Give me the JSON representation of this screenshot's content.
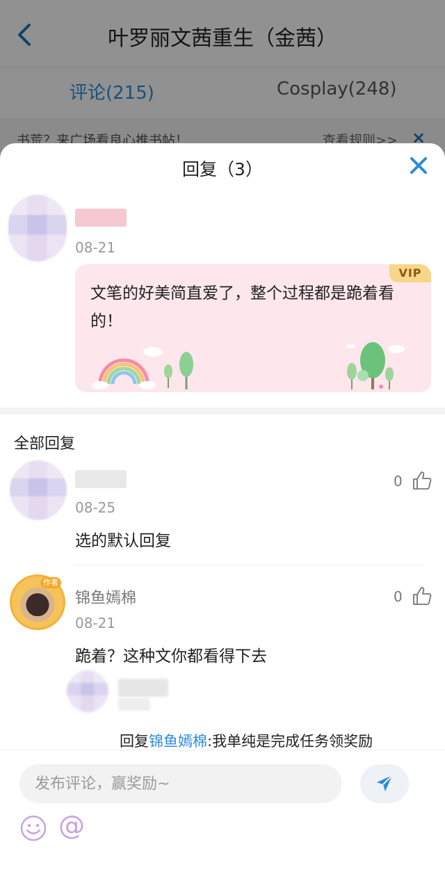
{
  "background": {
    "title": "叶罗丽文茜重生（金茜）",
    "tabs": [
      {
        "label": "评论(215)",
        "active": true
      },
      {
        "label": "Cosplay(248)",
        "active": false
      }
    ],
    "notice": {
      "text": "书荒？来广场看良心推书帖！",
      "rules_label": "查看规则>>",
      "close": "×"
    }
  },
  "sheet": {
    "title": "回复（3）",
    "post": {
      "date": "08-21",
      "vip_label": "VIP",
      "text": "文笔的好美简直爱了，整个过程都是跪着看的！"
    },
    "section_label": "全部回复",
    "replies": [
      {
        "name": "",
        "date": "08-25",
        "text": "选的默认回复",
        "likes": "0"
      },
      {
        "name": "锦鱼嫣棉",
        "author_tag": "作者",
        "date": "08-21",
        "text": "跪着？这种文你都看得下去",
        "likes": "0",
        "sub_reply": {
          "prefix": "回复",
          "mention": "锦鱼嫣棉",
          "text": ":我单纯是完成任务领奖励"
        }
      }
    ]
  },
  "composer": {
    "placeholder": "发布评论，赢奖励~"
  },
  "colors": {
    "accent": "#2a8bd8",
    "bubble": "#fde6ec",
    "vip": "#f7d68a",
    "emoji": "#c7a3e8"
  }
}
